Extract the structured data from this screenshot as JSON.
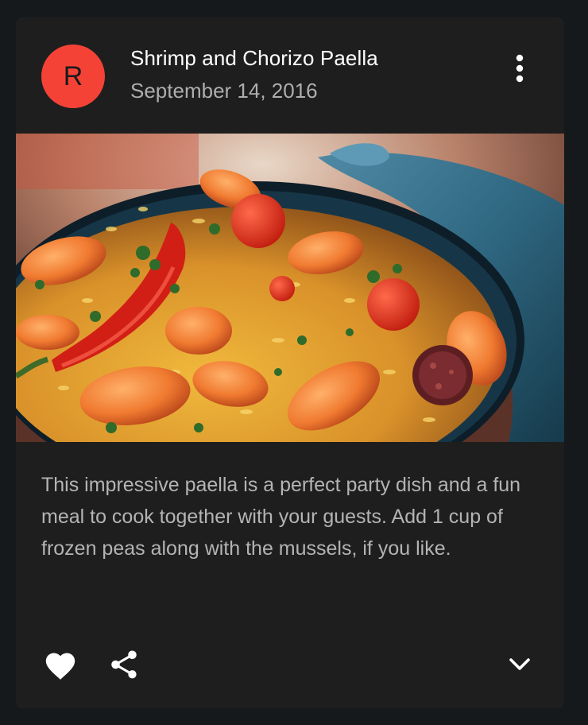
{
  "card": {
    "avatar_letter": "R",
    "title": "Shrimp and Chorizo Paella",
    "subheader": "September 14, 2016",
    "image_alt": "Paella dish",
    "body": "This impressive paella is a perfect party dish and a fun meal to cook together with your guests. Add 1 cup of frozen peas along with the mussels, if you like."
  },
  "icons": {
    "more": "more-vert-icon",
    "favorite": "heart-icon",
    "share": "share-icon",
    "expand": "chevron-down-icon"
  },
  "colors": {
    "avatar": "#f44336",
    "card_bg": "#1e1e1e",
    "page_bg": "#16191b"
  }
}
